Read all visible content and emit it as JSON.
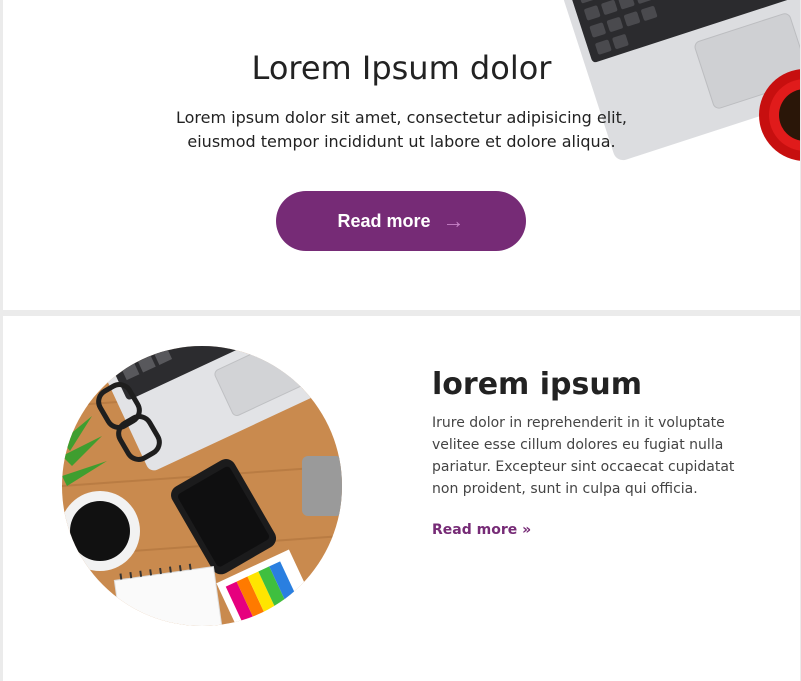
{
  "hero": {
    "title": "Lorem Ipsum dolor",
    "text": "Lorem ipsum dolor sit amet, consectetur adipisicing elit, eiusmod tempor incididunt ut labore et dolore aliqua.",
    "button_label": "Read more",
    "button_icon": "arrow-right-icon"
  },
  "feature": {
    "title": "lorem ipsum",
    "text": "Irure dolor in reprehenderit in it voluptate velitee esse cillum dolores eu fugiat nulla pariatur. Excepteur sint occaecat cupidatat non proident, sunt in culpa qui officia.",
    "link_label": "Read more »"
  },
  "colors": {
    "accent": "#762b76",
    "background": "#ffffff",
    "separator": "#ebebeb"
  }
}
